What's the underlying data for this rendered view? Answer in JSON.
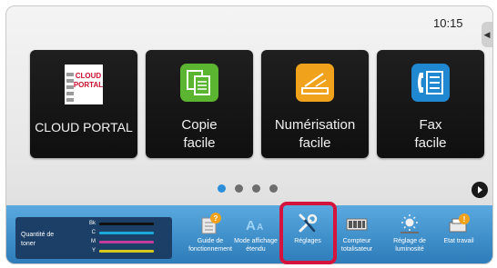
{
  "status_bar": {
    "time": "10:15"
  },
  "side_tab_icon": "chevron-left-icon",
  "tiles": [
    {
      "name": "cloud-portal",
      "label": "CLOUD PORTAL",
      "logo_lines": [
        "CLOUD",
        "PORTAL"
      ],
      "icon": "cloud-portal-logo"
    },
    {
      "name": "copy",
      "label": "Copie facile",
      "lines": [
        "Copie",
        "facile"
      ],
      "icon": "copy-icon"
    },
    {
      "name": "scan",
      "label": "Numérisation facile",
      "lines": [
        "Numérisation",
        "facile"
      ],
      "icon": "scan-icon"
    },
    {
      "name": "fax",
      "label": "Fax facile",
      "lines": [
        "Fax",
        "facile"
      ],
      "icon": "fax-icon"
    }
  ],
  "pagination": {
    "pages": 4,
    "current": 1
  },
  "toner": {
    "title": "Quantité de toner",
    "levels": [
      {
        "key": "Bk",
        "color": "#111111"
      },
      {
        "key": "C",
        "color": "#1aa9d9"
      },
      {
        "key": "M",
        "color": "#c23b9e"
      },
      {
        "key": "Y",
        "color": "#d8c81e"
      }
    ]
  },
  "shortcuts": [
    {
      "name": "guide",
      "label": "Guide de fonctionnement",
      "icon": "book-help-icon"
    },
    {
      "name": "display-mode",
      "label": "Mode affichage étendu",
      "icon": "text-size-icon"
    },
    {
      "name": "settings",
      "label": "Réglages",
      "icon": "wrench-screwdriver-icon"
    },
    {
      "name": "counter",
      "label": "Compteur totalisateur",
      "icon": "counter-icon"
    },
    {
      "name": "brightness",
      "label": "Réglage de luminosité",
      "icon": "brightness-icon"
    },
    {
      "name": "job-status",
      "label": "Etat travail",
      "icon": "job-status-icon"
    }
  ],
  "colors": {
    "accent": "#2a8fd8",
    "highlight": "#d4143c",
    "bottom_bar": "#3f8fca"
  }
}
